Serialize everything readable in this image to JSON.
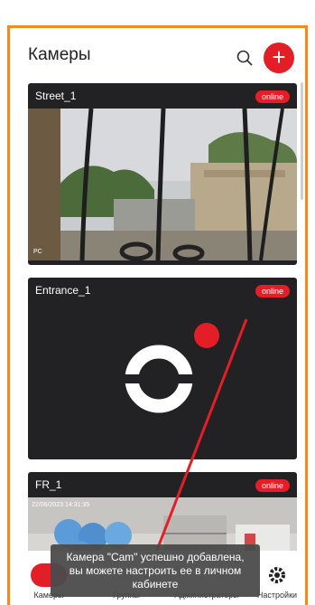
{
  "header": {
    "title": "Камеры"
  },
  "cameras": [
    {
      "name": "Street_1",
      "status": "online",
      "overlay_text": "PC",
      "timestamp": ""
    },
    {
      "name": "Entrance_1",
      "status": "online"
    },
    {
      "name": "FR_1",
      "status": "online",
      "timestamp": "22/06/2023 14:31:35"
    }
  ],
  "nav": {
    "items": [
      {
        "label": "Камеры",
        "icon": "camera-icon"
      },
      {
        "label": "Группы",
        "icon": "groups-icon"
      },
      {
        "label": "Администраторы",
        "icon": "admins-icon"
      },
      {
        "label": "Настройки",
        "icon": "gear-icon"
      }
    ]
  },
  "toast": {
    "line1": "Камера \"Cam\" успешно добавлена,",
    "line2": "вы можете настроить ее в личном",
    "line3": "кабинете"
  },
  "colors": {
    "accent": "#e41e26",
    "frame": "#f28a1e",
    "card_bg": "#222224"
  }
}
